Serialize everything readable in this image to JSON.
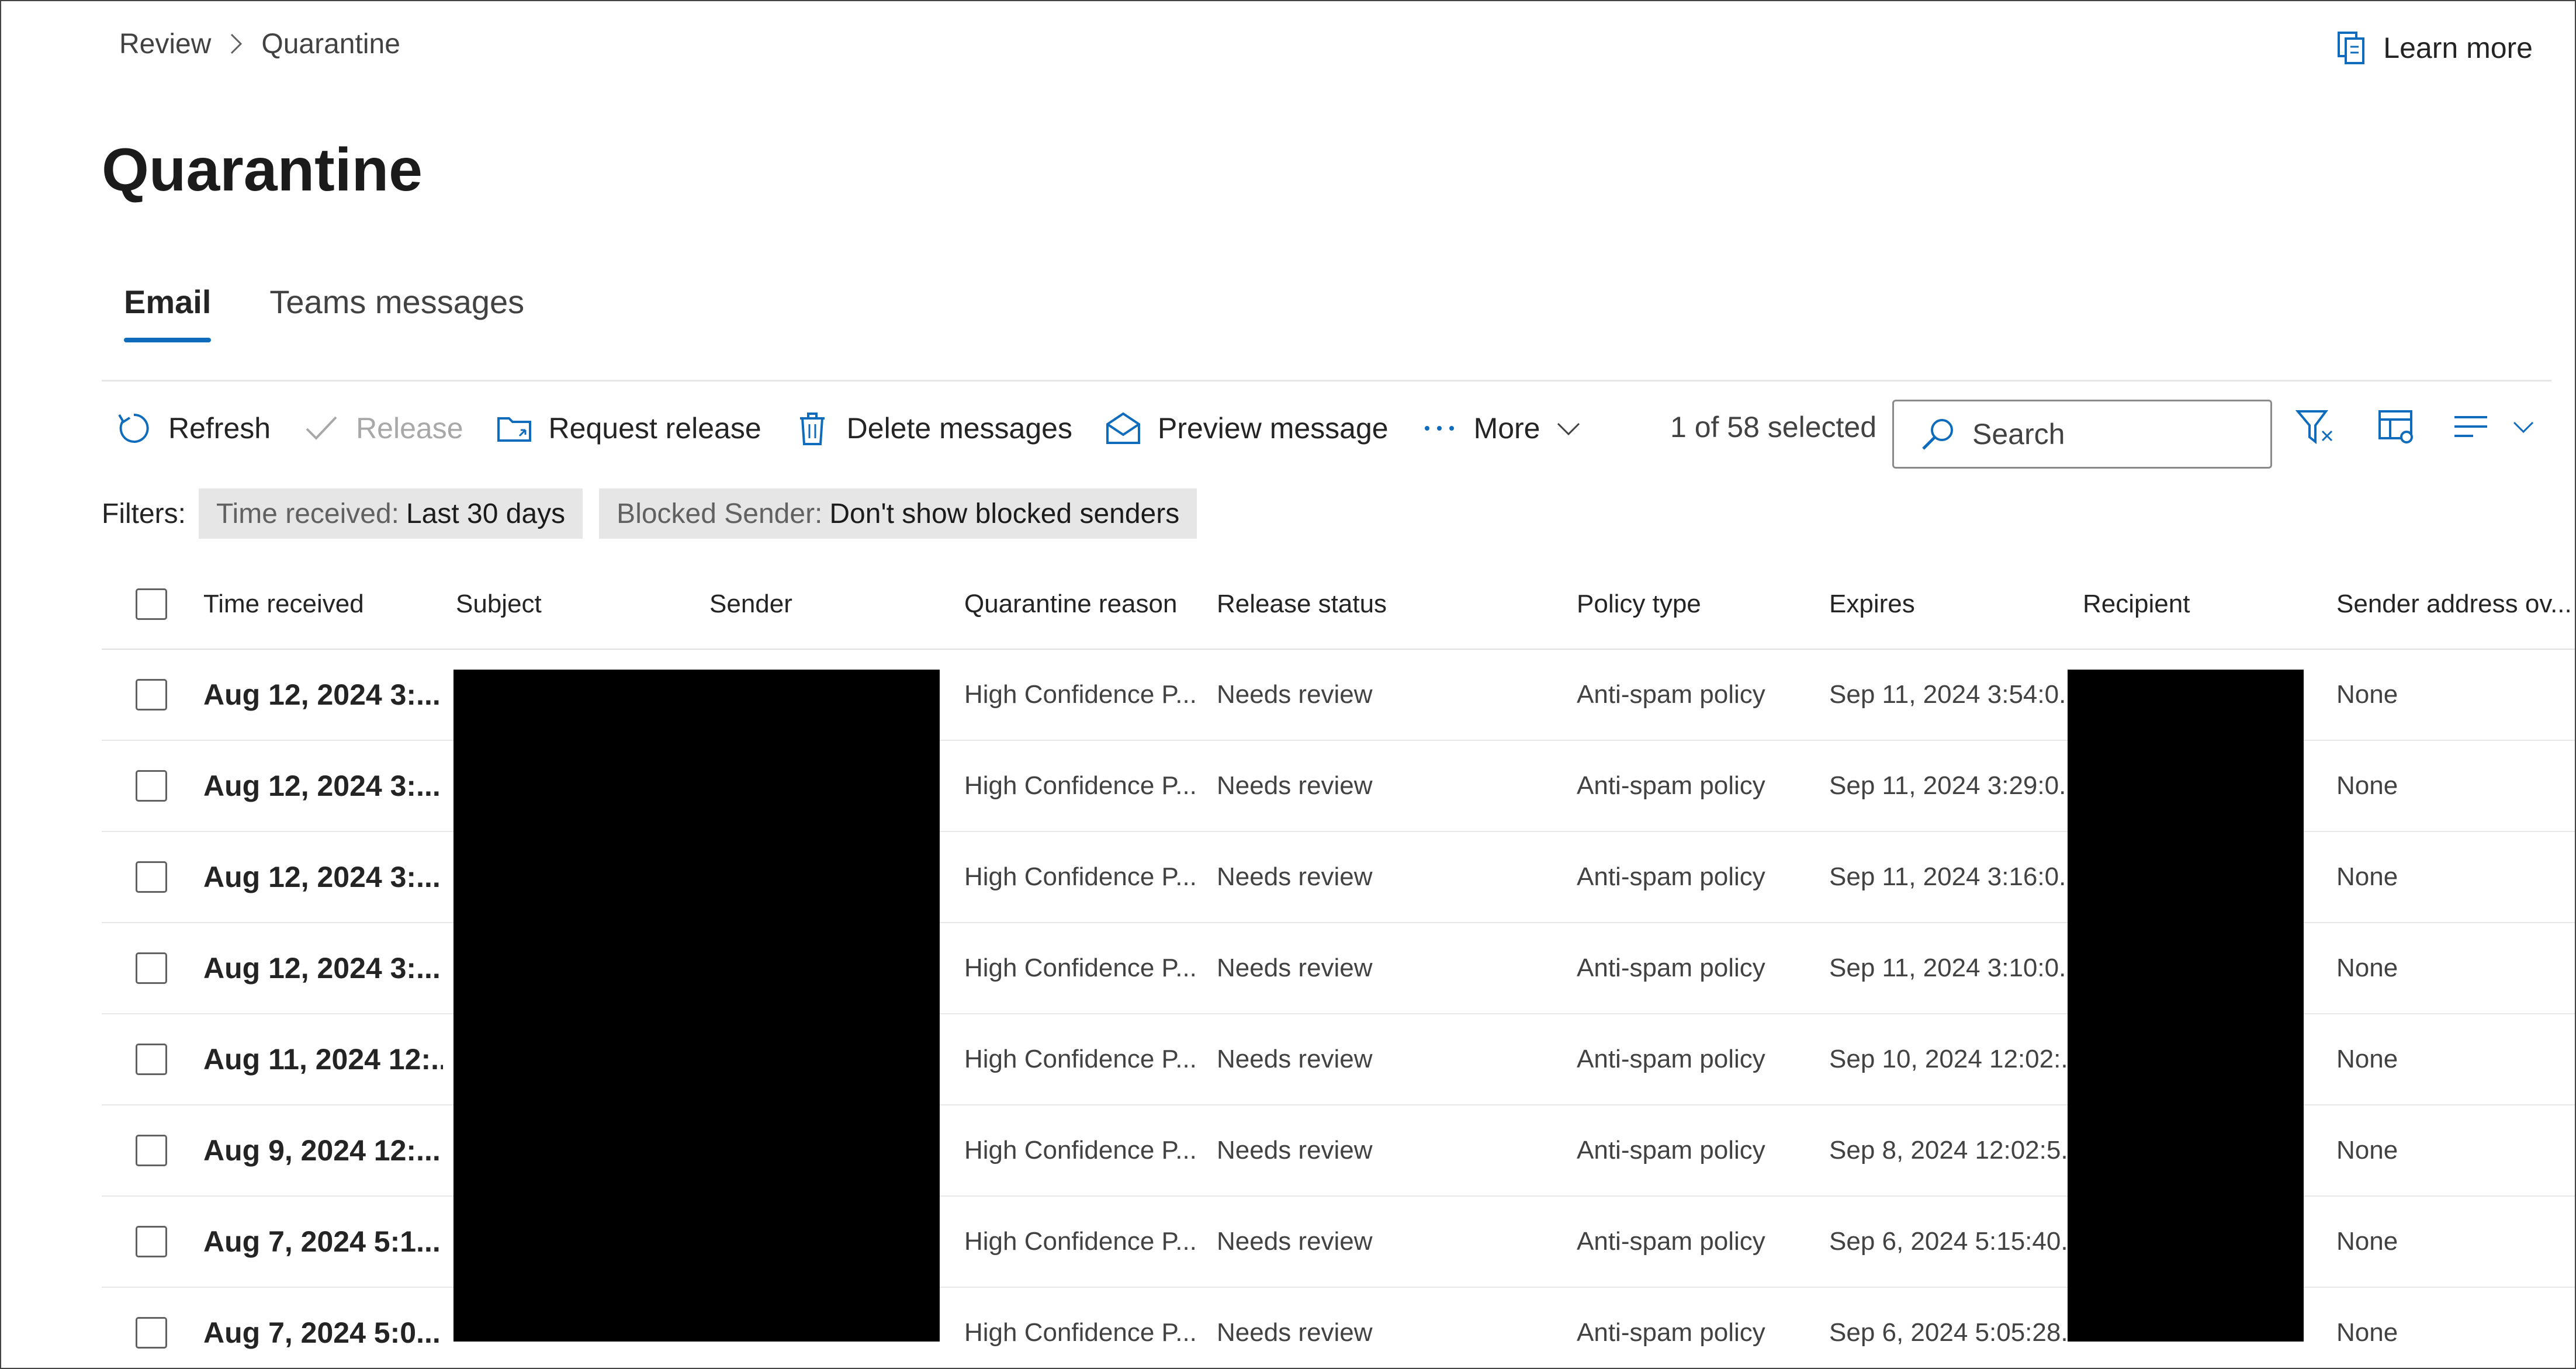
{
  "breadcrumb": {
    "parent": "Review",
    "current": "Quarantine"
  },
  "learn_more": "Learn more",
  "page_title": "Quarantine",
  "tabs": [
    {
      "label": "Email",
      "active": true
    },
    {
      "label": "Teams messages",
      "active": false
    }
  ],
  "toolbar": {
    "refresh": "Refresh",
    "release": "Release",
    "request_release": "Request release",
    "delete_messages": "Delete messages",
    "preview_message": "Preview message",
    "more": "More"
  },
  "selected_count": "1 of 58 selected",
  "search": {
    "placeholder": "Search",
    "value": ""
  },
  "filters": {
    "label": "Filters:",
    "chips": [
      {
        "key": "Time received:",
        "value": "Last 30 days"
      },
      {
        "key": "Blocked Sender:",
        "value": "Don't show blocked senders"
      }
    ]
  },
  "table": {
    "columns": [
      "Time received",
      "Subject",
      "Sender",
      "Quarantine reason",
      "Release status",
      "Policy type",
      "Expires",
      "Recipient",
      "Sender address ov..."
    ],
    "rows": [
      {
        "time": "Aug 12, 2024 3:...",
        "reason": "High Confidence P...",
        "status": "Needs review",
        "policy": "Anti-spam policy",
        "expires": "Sep 11, 2024 3:54:0...",
        "override": "None"
      },
      {
        "time": "Aug 12, 2024 3:...",
        "reason": "High Confidence P...",
        "status": "Needs review",
        "policy": "Anti-spam policy",
        "expires": "Sep 11, 2024 3:29:0...",
        "override": "None"
      },
      {
        "time": "Aug 12, 2024 3:...",
        "reason": "High Confidence P...",
        "status": "Needs review",
        "policy": "Anti-spam policy",
        "expires": "Sep 11, 2024 3:16:0...",
        "override": "None"
      },
      {
        "time": "Aug 12, 2024 3:...",
        "reason": "High Confidence P...",
        "status": "Needs review",
        "policy": "Anti-spam policy",
        "expires": "Sep 11, 2024 3:10:0...",
        "override": "None"
      },
      {
        "time": "Aug 11, 2024 12:...",
        "reason": "High Confidence P...",
        "status": "Needs review",
        "policy": "Anti-spam policy",
        "expires": "Sep 10, 2024 12:02:...",
        "override": "None"
      },
      {
        "time": "Aug 9, 2024 12:...",
        "reason": "High Confidence P...",
        "status": "Needs review",
        "policy": "Anti-spam policy",
        "expires": "Sep 8, 2024 12:02:5...",
        "override": "None"
      },
      {
        "time": "Aug 7, 2024 5:1...",
        "reason": "High Confidence P...",
        "status": "Needs review",
        "policy": "Anti-spam policy",
        "expires": "Sep 6, 2024 5:15:40...",
        "override": "None"
      },
      {
        "time": "Aug 7, 2024 5:0...",
        "reason": "High Confidence P...",
        "status": "Needs review",
        "policy": "Anti-spam policy",
        "expires": "Sep 6, 2024 5:05:28...",
        "override": "None"
      }
    ]
  },
  "colors": {
    "accent": "#0f6cbd",
    "chip_bg": "#e6e6e6",
    "redaction": "#000000"
  }
}
